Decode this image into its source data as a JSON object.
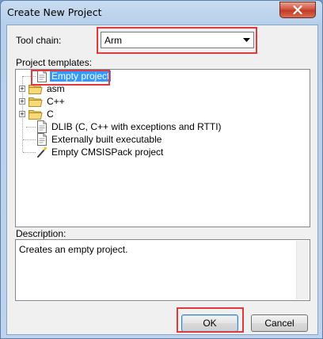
{
  "window": {
    "title": "Create New Project"
  },
  "toolchain": {
    "label": "Tool chain:",
    "value": "Arm"
  },
  "templates": {
    "label": "Project templates:",
    "items": [
      {
        "label": "Empty project",
        "icon": "document-icon",
        "selected": true
      },
      {
        "label": "asm",
        "icon": "folder-icon",
        "expandable": true
      },
      {
        "label": "C++",
        "icon": "folder-icon",
        "expandable": true
      },
      {
        "label": "C",
        "icon": "folder-icon",
        "expandable": true
      },
      {
        "label": "DLIB (C, C++ with exceptions and RTTI)",
        "icon": "document-icon"
      },
      {
        "label": "Externally built executable",
        "icon": "document-icon"
      },
      {
        "label": "Empty CMSISPack project",
        "icon": "magic-wand-icon"
      }
    ]
  },
  "description": {
    "label": "Description:",
    "text": "Creates an empty project."
  },
  "buttons": {
    "ok": "OK",
    "cancel": "Cancel"
  },
  "colors": {
    "highlight": "#e0393e",
    "selection": "#3399ff"
  }
}
